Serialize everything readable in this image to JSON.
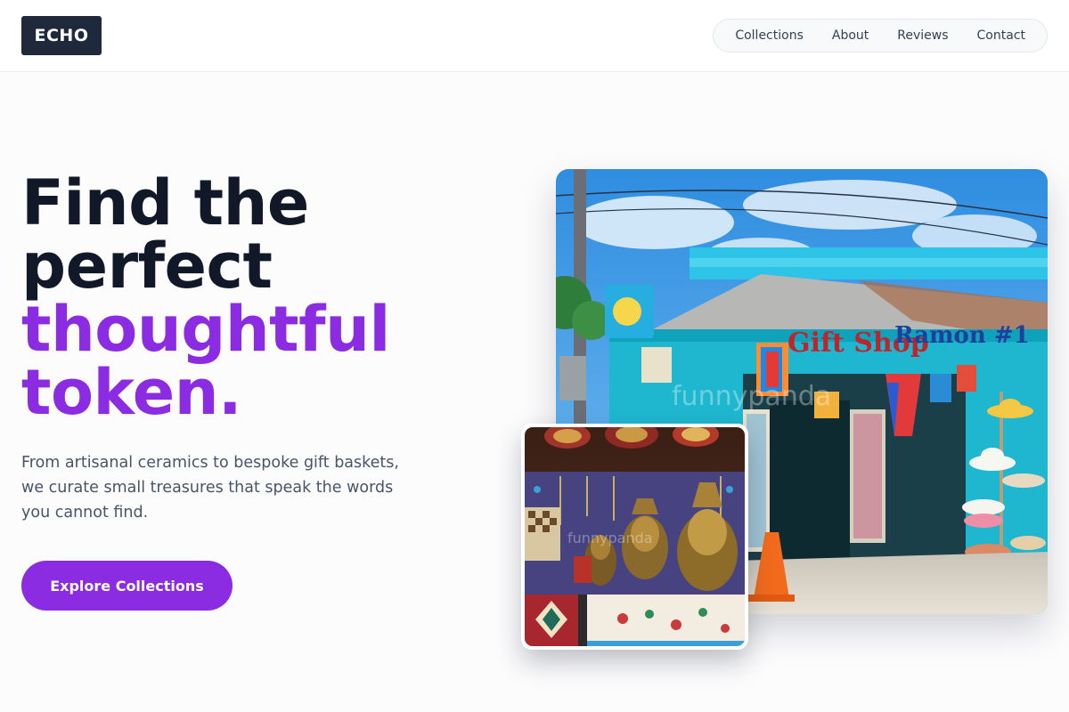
{
  "brand": {
    "logo_text": "ECHO"
  },
  "nav": {
    "items": [
      {
        "label": "Collections"
      },
      {
        "label": "About"
      },
      {
        "label": "Reviews"
      },
      {
        "label": "Contact"
      }
    ]
  },
  "hero": {
    "headline_lines": [
      "Find the",
      "perfect"
    ],
    "headline_accent_lines": [
      "thoughtful",
      "token."
    ],
    "description": "From artisanal ceramics to bespoke gift baskets, we curate small treasures that speak the words you cannot find.",
    "cta_label": "Explore Collections"
  },
  "images": {
    "main": {
      "description_icon": "gift-shop-photo",
      "sign_text": "Gift Shop",
      "sign_text_2": "Ramon #1",
      "watermark": "funnypanda"
    },
    "inset": {
      "description_icon": "souvenir-statues-photo",
      "watermark": "funnypanda"
    }
  },
  "colors": {
    "accent": "#8b2be2",
    "logo_bg": "#1e293b",
    "headline": "#111827",
    "body_text": "#475569"
  }
}
